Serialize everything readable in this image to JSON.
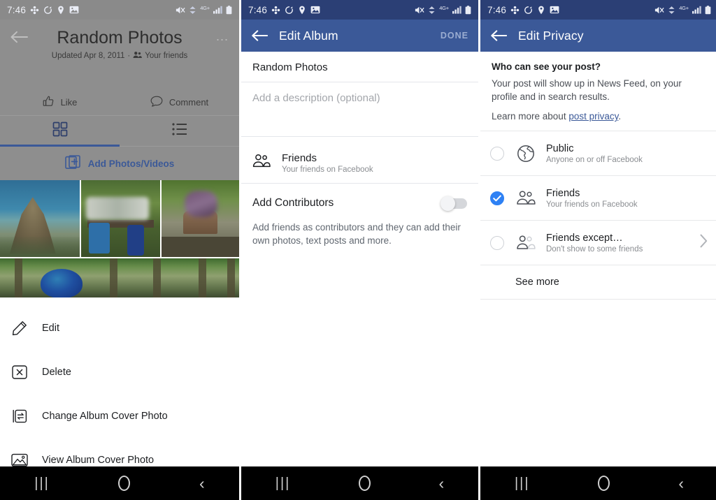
{
  "status_bar": {
    "time": "7:46",
    "left_icons": [
      "shortcut-icon",
      "sync-icon",
      "location-icon",
      "screenshot-icon"
    ],
    "right_icons": [
      "mute-icon",
      "nfc-icon",
      "lte-label",
      "signal-icon",
      "battery-icon"
    ],
    "lte_label": "4G+"
  },
  "nav_bar": {
    "recents_label": "|||",
    "home_label": "",
    "back_label": "‹"
  },
  "colors": {
    "facebook_blue": "#3b5998",
    "status_bar_blue": "#2b3f75",
    "accent_blue": "#2e81f4",
    "link_blue": "#3b5998",
    "divider": "#e4e6eb",
    "dim_overlay": "#8e8e8e"
  },
  "panel_album": {
    "title": "Random Photos",
    "subtitle_updated": "Updated Apr 8, 2011",
    "subtitle_sep": "·",
    "subtitle_audience": "Your friends",
    "back_icon": "back-arrow-icon",
    "more_icon": "overflow-menu-icon",
    "actions": [
      {
        "label": "Like",
        "icon": "thumbs-up-icon"
      },
      {
        "label": "Comment",
        "icon": "comment-bubble-icon"
      }
    ],
    "tabs": [
      {
        "name": "grid-view",
        "icon": "grid-icon",
        "active": true
      },
      {
        "name": "list-view",
        "icon": "list-icon",
        "active": false
      }
    ],
    "add_photos_label": "Add Photos/Videos",
    "add_photos_icon": "add-photo-icon",
    "menu_items": [
      {
        "label": "Edit",
        "icon": "pencil-icon"
      },
      {
        "label": "Delete",
        "icon": "delete-x-icon"
      },
      {
        "label": "Change Album Cover Photo",
        "icon": "swap-photo-icon"
      },
      {
        "label": "View Album Cover Photo",
        "icon": "image-icon"
      }
    ]
  },
  "panel_edit_album": {
    "app_bar_title": "Edit Album",
    "done_label": "DONE",
    "back_icon": "back-arrow-icon",
    "album_name_value": "Random Photos",
    "description_placeholder": "Add a description (optional)",
    "audience": {
      "icon": "friends-icon",
      "title": "Friends",
      "subtitle": "Your friends on Facebook"
    },
    "contributors": {
      "label": "Add Contributors",
      "toggle_state": "off",
      "description": "Add friends as contributors and they can add their own photos, text posts and more."
    }
  },
  "panel_edit_privacy": {
    "app_bar_title": "Edit Privacy",
    "back_icon": "back-arrow-icon",
    "question": "Who can see your post?",
    "explanation": "Your post will show up in News Feed, on your profile and in search results.",
    "learn_more_prefix": "Learn more about ",
    "learn_more_link": "post privacy",
    "learn_more_suffix": ".",
    "options": [
      {
        "title": "Public",
        "subtitle": "Anyone on or off Facebook",
        "icon": "globe-icon",
        "selected": false,
        "has_chevron": false
      },
      {
        "title": "Friends",
        "subtitle": "Your friends on Facebook",
        "icon": "friends-icon",
        "selected": true,
        "has_chevron": false
      },
      {
        "title": "Friends except…",
        "subtitle": "Don't show to some friends",
        "icon": "friends-except-icon",
        "selected": false,
        "has_chevron": true
      }
    ],
    "see_more_label": "See more"
  }
}
